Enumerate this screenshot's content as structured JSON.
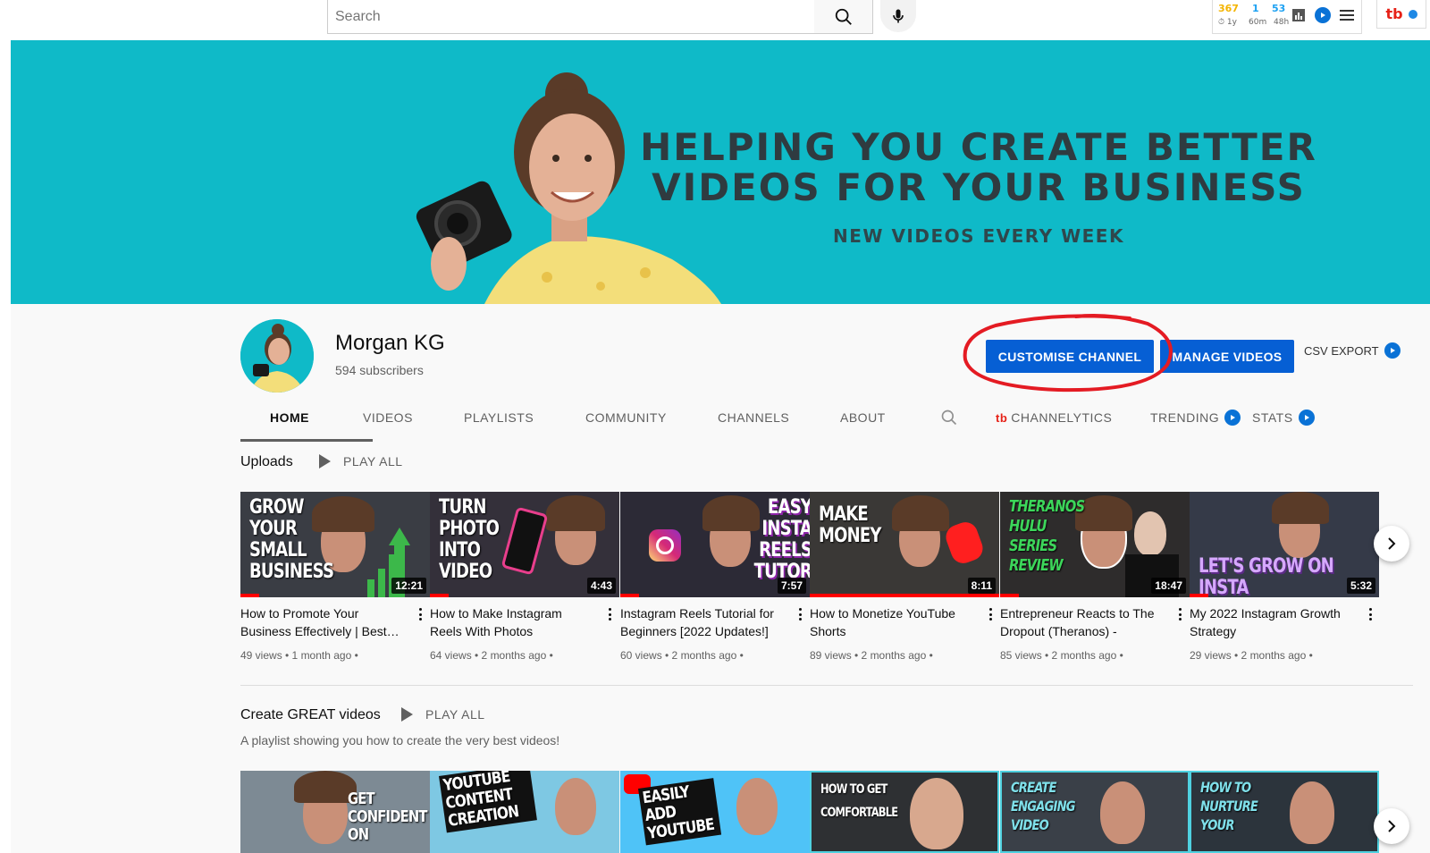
{
  "search": {
    "placeholder": "Search"
  },
  "extension": {
    "stats": [
      {
        "value": "367",
        "sub": "1y",
        "color": "#f4b400"
      },
      {
        "value": "1",
        "sub": "60m",
        "color": "#1da1f2"
      },
      {
        "value": "53",
        "sub": "48h",
        "color": "#1da1f2"
      }
    ]
  },
  "banner": {
    "line1": "HELPING YOU CREATE BETTER",
    "line2": "VIDEOS FOR YOUR BUSINESS",
    "line3": "NEW VIDEOS EVERY WEEK"
  },
  "channel": {
    "name": "Morgan KG",
    "subscribers": "594 subscribers",
    "customise_label": "CUSTOMISE CHANNEL",
    "manage_label": "MANAGE VIDEOS",
    "csv_label": "CSV EXPORT"
  },
  "tabs": {
    "home": "HOME",
    "videos": "VIDEOS",
    "playlists": "PLAYLISTS",
    "community": "COMMUNITY",
    "channels": "CHANNELS",
    "about": "ABOUT",
    "channelytics": "CHANNELYTICS",
    "trending": "TRENDING",
    "stats": "STATS"
  },
  "uploads": {
    "title": "Uploads",
    "play_all": "PLAY ALL",
    "videos": [
      {
        "title": "How to Promote Your Business Effectively | Best…",
        "meta": "49 views • 1 month ago •",
        "duration": "12:21",
        "thumb_text": "GROW YOUR SMALL BUSINESS",
        "progress": 0.1
      },
      {
        "title": "How to Make Instagram Reels With Photos",
        "meta": "64 views • 2 months ago •",
        "duration": "4:43",
        "thumb_text": "TURN PHOTO INTO VIDEO",
        "progress": 0.1
      },
      {
        "title": "Instagram Reels Tutorial for Beginners [2022 Updates!]",
        "meta": "60 views • 2 months ago •",
        "duration": "7:57",
        "thumb_text": "EASY INSTA REELS TUTOR",
        "progress": 0.1
      },
      {
        "title": "How to Monetize YouTube Shorts",
        "meta": "89 views • 2 months ago •",
        "duration": "8:11",
        "thumb_text": "MAKE MONEY",
        "progress": 1.0
      },
      {
        "title": "Entrepreneur Reacts to The Dropout (Theranos) - Episo…",
        "meta": "85 views • 2 months ago •",
        "duration": "18:47",
        "thumb_text": "THERANOS HULU SERIES REVIEW",
        "progress": 0.1
      },
      {
        "title": "My 2022 Instagram Growth Strategy",
        "meta": "29 views • 2 months ago •",
        "duration": "5:32",
        "thumb_text": "LET'S GROW ON INSTA",
        "progress": 0.1
      }
    ]
  },
  "playlist": {
    "title": "Create GREAT videos",
    "play_all": "PLAY ALL",
    "description": "A playlist showing you how to create the very best videos!",
    "thumbs": [
      "GET CONFIDENT ON",
      "YOUTUBE CONTENT CREATION",
      "EASILY ADD YOUTUBE",
      "HOW TO GET COMFORTABLE",
      "CREATE ENGAGING VIDEO",
      "HOW TO NURTURE YOUR"
    ]
  }
}
